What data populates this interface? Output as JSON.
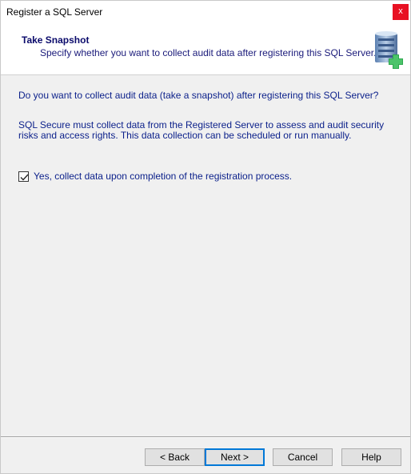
{
  "window": {
    "title": "Register a SQL Server",
    "close_label": "x"
  },
  "header": {
    "title": "Take Snapshot",
    "subtitle": "Specify whether you want to collect audit data after registering this SQL Server.",
    "icon": "server-add-icon"
  },
  "content": {
    "question": "Do you want to collect audit data (take a snapshot) after registering this SQL Server?",
    "description": "SQL Secure must collect data from the Registered Server to assess and audit security risks and access rights. This data collection can be scheduled or run manually.",
    "checkbox": {
      "label": "Yes, collect data upon completion of the registration process.",
      "checked": true
    }
  },
  "buttons": {
    "back": "< Back",
    "next": "Next >",
    "cancel": "Cancel",
    "help": "Help"
  }
}
